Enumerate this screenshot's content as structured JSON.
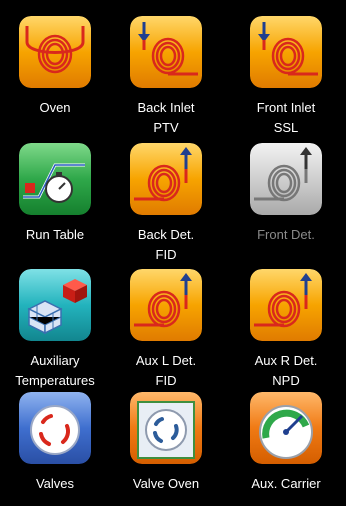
{
  "tiles": [
    {
      "key": "oven",
      "icon": "oven-coil-icon",
      "line1": "Oven",
      "line2": "",
      "enabled": true
    },
    {
      "key": "back_inlet",
      "icon": "back-inlet-coil-icon",
      "line1": "Back Inlet",
      "line2": "PTV",
      "enabled": true
    },
    {
      "key": "front_inlet",
      "icon": "front-inlet-coil-icon",
      "line1": "Front Inlet",
      "line2": "SSL",
      "enabled": true
    },
    {
      "key": "run_table",
      "icon": "run-table-stopwatch-icon",
      "line1": "Run Table",
      "line2": "",
      "enabled": true
    },
    {
      "key": "back_det",
      "icon": "back-detector-coil-icon",
      "line1": "Back Det.",
      "line2": "FID",
      "enabled": true
    },
    {
      "key": "front_det",
      "icon": "front-detector-coil-icon",
      "line1": "Front Det.",
      "line2": "",
      "enabled": false
    },
    {
      "key": "aux_temps",
      "icon": "auxiliary-temperatures-cubes-icon",
      "line1": "Auxiliary",
      "line2": "Temperatures",
      "enabled": true
    },
    {
      "key": "aux_l_det",
      "icon": "aux-left-detector-coil-icon",
      "line1": "Aux L Det.",
      "line2": "FID",
      "enabled": true
    },
    {
      "key": "aux_r_det",
      "icon": "aux-right-detector-coil-icon",
      "line1": "Aux R Det.",
      "line2": "NPD",
      "enabled": true
    },
    {
      "key": "valves",
      "icon": "valves-icon",
      "line1": "Valves",
      "line2": "",
      "enabled": true
    },
    {
      "key": "valve_oven",
      "icon": "valve-oven-icon",
      "line1": "Valve Oven",
      "line2": "",
      "enabled": true
    },
    {
      "key": "aux_carrier",
      "icon": "aux-carrier-gauge-icon",
      "line1": "Aux. Carrier",
      "line2": "",
      "enabled": true
    }
  ],
  "colors": {
    "background": "#000000",
    "label": "#ffffff",
    "label_disabled": "#8a8a8a",
    "orange": "#f7a400",
    "coil": "#d9281c"
  }
}
